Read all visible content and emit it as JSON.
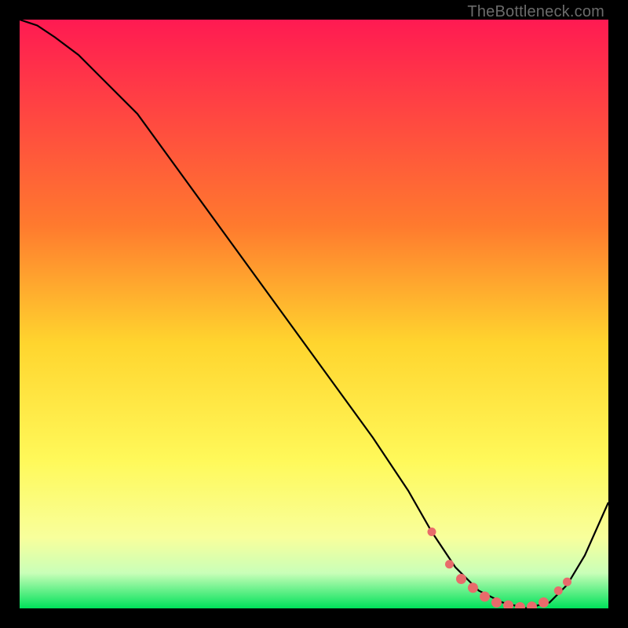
{
  "watermark": "TheBottleneck.com",
  "colors": {
    "background": "#000000",
    "gradient_top": "#ff1a52",
    "gradient_mid1": "#ff7a2e",
    "gradient_mid2": "#ffd52e",
    "gradient_mid3": "#fff95a",
    "gradient_mid4": "#f8ff9c",
    "gradient_band": "#c9ffb8",
    "gradient_bottom": "#00e15a",
    "curve": "#000000",
    "markers": "#e86b6b"
  },
  "chart_data": {
    "type": "line",
    "title": "",
    "xlabel": "",
    "ylabel": "",
    "xlim": [
      0,
      100
    ],
    "ylim": [
      0,
      100
    ],
    "grid": false,
    "legend": false,
    "series": [
      {
        "name": "bottleneck-curve",
        "x": [
          0,
          3,
          6,
          10,
          15,
          20,
          28,
          36,
          44,
          52,
          60,
          66,
          70,
          74,
          78,
          82,
          86,
          90,
          93,
          96,
          100
        ],
        "y": [
          100,
          99,
          97,
          94,
          89,
          84,
          73,
          62,
          51,
          40,
          29,
          20,
          13,
          7,
          3,
          1,
          0,
          1,
          4,
          9,
          18
        ]
      }
    ],
    "markers": {
      "name": "highlight-points",
      "x": [
        70.0,
        73.0,
        75.0,
        77.0,
        79.0,
        81.0,
        83.0,
        85.0,
        87.0,
        89.0,
        91.5,
        93.0
      ],
      "y": [
        13.0,
        7.5,
        5.0,
        3.5,
        2.0,
        1.0,
        0.5,
        0.2,
        0.3,
        1.0,
        3.0,
        4.5
      ],
      "r": [
        5.5,
        5.5,
        6.5,
        6.5,
        6.5,
        6.5,
        6.5,
        6.5,
        6.5,
        6.5,
        5.5,
        5.5
      ]
    },
    "gradient_stops": [
      {
        "offset": 0.0,
        "key": "gradient_top"
      },
      {
        "offset": 0.35,
        "key": "gradient_mid1"
      },
      {
        "offset": 0.55,
        "key": "gradient_mid2"
      },
      {
        "offset": 0.75,
        "key": "gradient_mid3"
      },
      {
        "offset": 0.88,
        "key": "gradient_mid4"
      },
      {
        "offset": 0.94,
        "key": "gradient_band"
      },
      {
        "offset": 1.0,
        "key": "gradient_bottom"
      }
    ]
  }
}
